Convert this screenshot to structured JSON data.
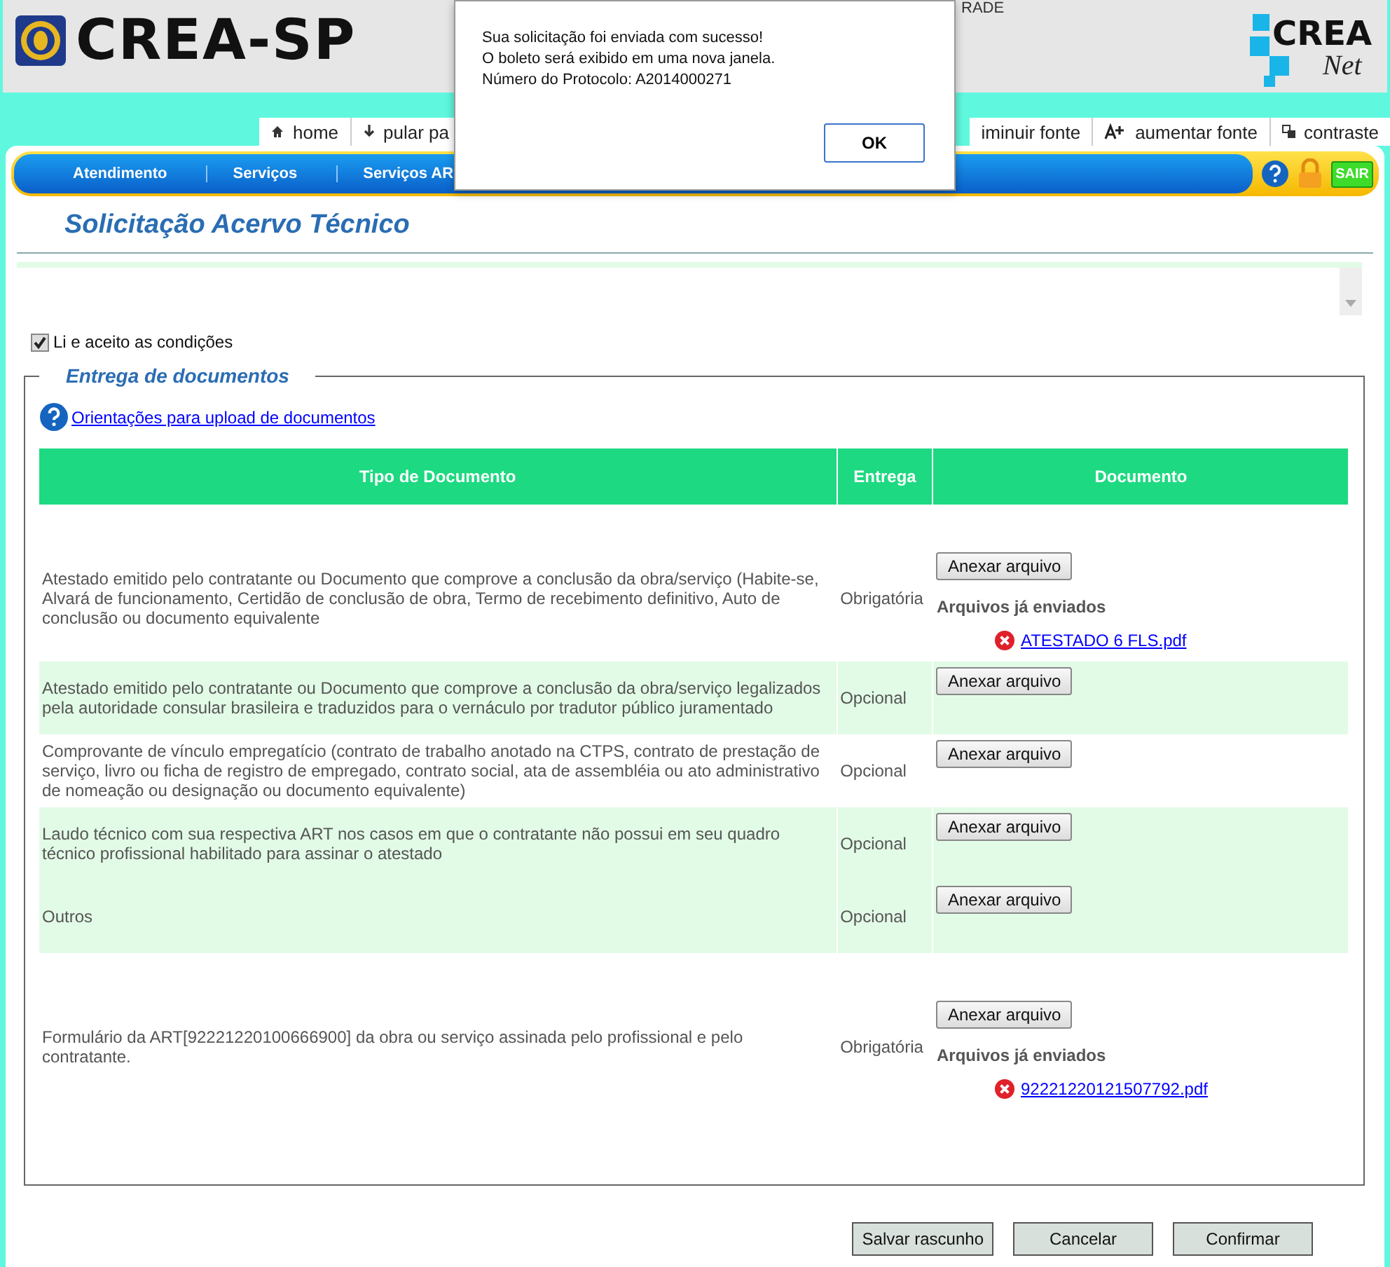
{
  "header": {
    "logo_text": "CREA-SP",
    "partial_text": "RADE",
    "brand_top": "CREA",
    "brand_bottom": "Net"
  },
  "toolbar": {
    "left": [
      "home",
      "pular pa"
    ],
    "right": [
      "iminuir fonte",
      "aumentar fonte",
      "contraste"
    ]
  },
  "nav": {
    "items": [
      "Atendimento",
      "Serviços",
      "Serviços AR"
    ],
    "exit_label": "SAIR"
  },
  "dialog": {
    "lines": [
      "Sua solicitação foi enviada com sucesso!",
      "O boleto será exibido em uma nova janela.",
      "Número do Protocolo: A2014000271"
    ],
    "button": "OK"
  },
  "page_title": "Solicitação Acervo Técnico",
  "terms": {
    "label": "Li e aceito as condições",
    "checked": true
  },
  "fieldset": {
    "legend": "Entrega de documentos",
    "help_link": "Orientações para upload de documentos",
    "table": {
      "columns": [
        "Tipo de Documento",
        "Entrega",
        "Documento"
      ],
      "rows": [
        {
          "description": "Atestado emitido pelo contratante ou Documento que comprove a conclusão da obra/serviço (Habite-se, Alvará de funcionamento, Certidão de conclusão de obra, Termo de recebimento definitivo, Auto de conclusão ou documento equivalente",
          "delivery": "Obrigatória",
          "button": "Anexar arquivo",
          "highlighted": false,
          "sent_title": "Arquivos já enviados",
          "files": [
            "ATESTADO 6 FLS.pdf"
          ]
        },
        {
          "description": "Atestado emitido pelo contratante ou Documento que comprove a conclusão da obra/serviço legalizados pela autoridade consular brasileira e traduzidos para o vernáculo por tradutor público juramentado",
          "delivery": "Opcional",
          "button": "Anexar arquivo",
          "highlighted": true
        },
        {
          "description": "Comprovante de vínculo empregatício (contrato de trabalho anotado na CTPS, contrato de prestação de serviço, livro ou ficha de registro de empregado, contrato social, ata de assembléia ou ato administrativo de nomeação ou designação ou documento equivalente)",
          "delivery": "Opcional",
          "button": "Anexar arquivo",
          "highlighted": false
        },
        {
          "description": "Laudo técnico com sua respectiva ART nos casos em que o contratante não possui em seu quadro técnico profissional habilitado para assinar o atestado",
          "delivery": "Opcional",
          "button": "Anexar arquivo",
          "highlighted": true
        },
        {
          "description": "Outros",
          "delivery": "Opcional",
          "button": "Anexar arquivo",
          "highlighted": true
        },
        {
          "description": "Formulário da ART[92221220100666900] da obra ou serviço assinada pelo profissional e pelo contratante.",
          "delivery": "Obrigatória",
          "button": "Anexar arquivo",
          "highlighted": false,
          "sent_title": "Arquivos já enviados",
          "files": [
            "92221220121507792.pdf"
          ]
        }
      ]
    }
  },
  "actions": [
    "Salvar rascunho",
    "Cancelar",
    "Confirmar"
  ]
}
